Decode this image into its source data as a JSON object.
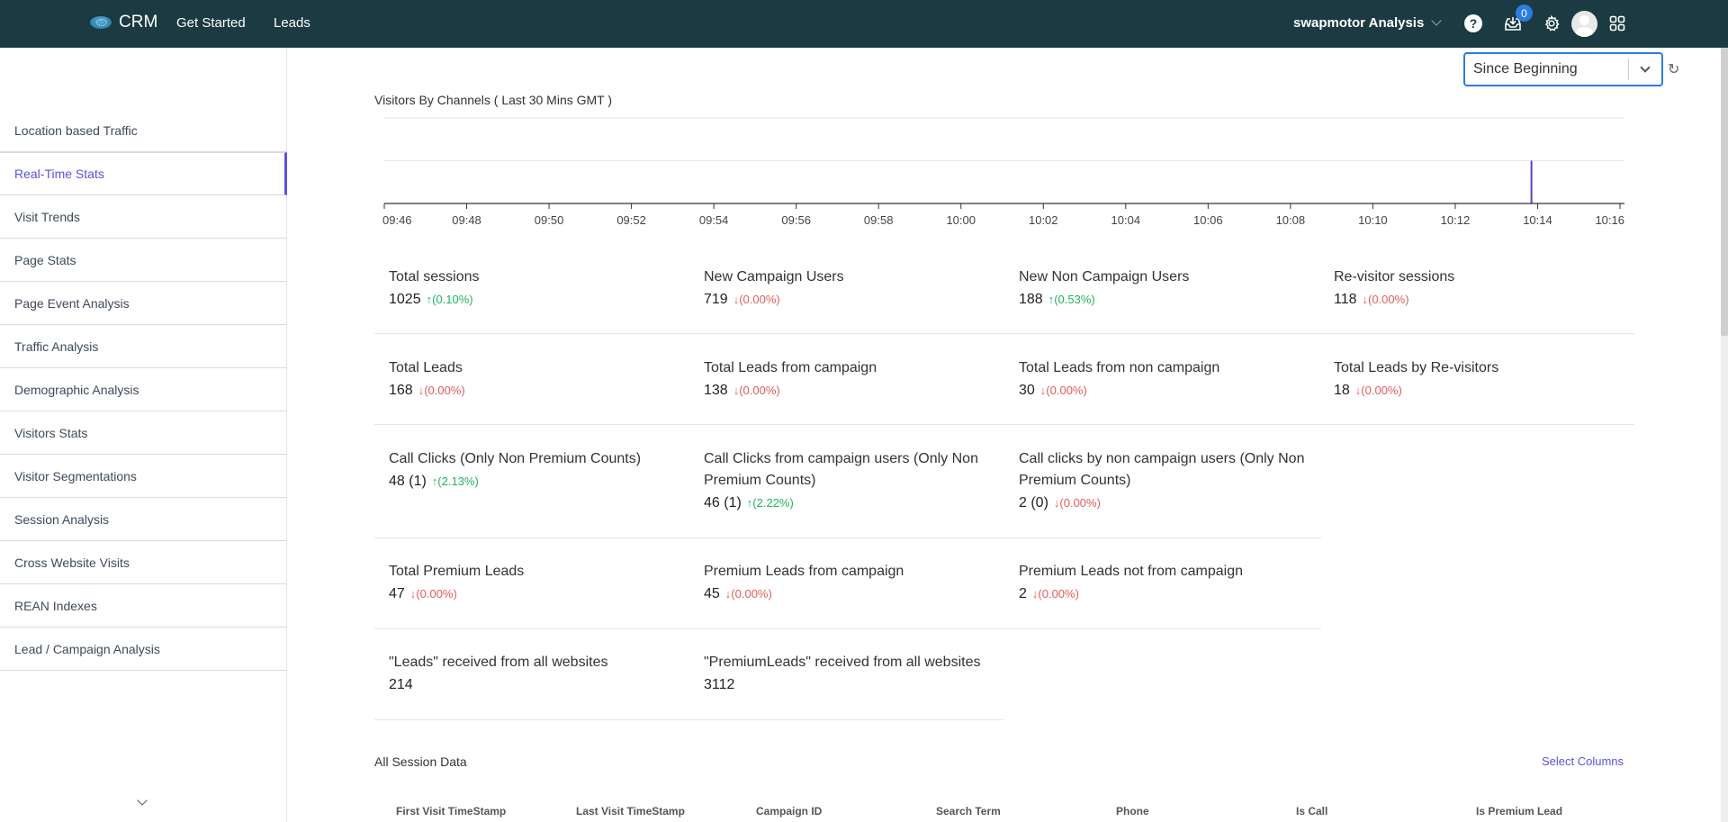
{
  "header": {
    "brand": "CRM",
    "nav": [
      "Get Started",
      "Leads"
    ],
    "account": "swapmotor Analysis",
    "notification_count": "0",
    "icons": [
      "help-icon",
      "inbox-download-icon",
      "gear-icon",
      "avatar",
      "apps-grid-icon"
    ]
  },
  "sidebar": {
    "items": [
      {
        "label": "Location based Traffic",
        "active": false
      },
      {
        "label": "Real-Time Stats",
        "active": true
      },
      {
        "label": "Visit Trends",
        "active": false
      },
      {
        "label": "Page Stats",
        "active": false
      },
      {
        "label": "Page Event Analysis",
        "active": false
      },
      {
        "label": "Traffic Analysis",
        "active": false
      },
      {
        "label": "Demographic Analysis",
        "active": false
      },
      {
        "label": "Visitors Stats",
        "active": false
      },
      {
        "label": "Visitor Segmentations",
        "active": false
      },
      {
        "label": "Session Analysis",
        "active": false
      },
      {
        "label": "Cross Website Visits",
        "active": false
      },
      {
        "label": "REAN Indexes",
        "active": false
      },
      {
        "label": "Lead / Campaign Analysis",
        "active": false
      }
    ]
  },
  "filter": {
    "range": "Since Beginning"
  },
  "chart_data": {
    "type": "bar",
    "title": "Visitors By Channels ( Last 30 Mins GMT )",
    "x_ticks": [
      "09:46",
      "09:48",
      "09:50",
      "09:52",
      "09:54",
      "09:56",
      "09:58",
      "10:00",
      "10:02",
      "10:04",
      "10:06",
      "10:08",
      "10:10",
      "10:12",
      "10:14",
      "10:16"
    ],
    "x_range_minutes": [
      0,
      30
    ],
    "ylim": [
      0,
      2
    ],
    "grid": true,
    "series": [
      {
        "name": "Visitors",
        "color": "#5048c8",
        "points": [
          {
            "x": "10:13:50",
            "minute": 27.85,
            "y": 1
          }
        ]
      }
    ]
  },
  "stats": {
    "row1": [
      {
        "label": "Total sessions",
        "value": "1025",
        "change": "↑(0.10%)",
        "dir": "up"
      },
      {
        "label": "New Campaign Users",
        "value": "719",
        "change": "↓(0.00%)",
        "dir": "down"
      },
      {
        "label": "New Non Campaign Users",
        "value": "188",
        "change": "↑(0.53%)",
        "dir": "up"
      },
      {
        "label": "Re-visitor sessions",
        "value": "118",
        "change": "↓(0.00%)",
        "dir": "down"
      }
    ],
    "row2": [
      {
        "label": "Total Leads",
        "value": "168",
        "change": "↓(0.00%)",
        "dir": "down"
      },
      {
        "label": "Total Leads from campaign",
        "value": "138",
        "change": "↓(0.00%)",
        "dir": "down"
      },
      {
        "label": "Total Leads from non campaign",
        "value": "30",
        "change": "↓(0.00%)",
        "dir": "down"
      },
      {
        "label": "Total Leads by Re-visitors",
        "value": "18",
        "change": "↓(0.00%)",
        "dir": "down"
      }
    ],
    "row3": [
      {
        "label": "Call Clicks (Only Non Premium Counts)",
        "value": "48 (1)",
        "change": "↑(2.13%)",
        "dir": "up"
      },
      {
        "label": "Call Clicks from campaign users (Only Non Premium Counts)",
        "value": "46 (1)",
        "change": "↑(2.22%)",
        "dir": "up"
      },
      {
        "label": "Call clicks by non campaign users (Only Non Premium Counts)",
        "value": "2 (0)",
        "change": "↓(0.00%)",
        "dir": "down"
      }
    ],
    "row4": [
      {
        "label": "Total Premium Leads",
        "value": "47",
        "change": "↓(0.00%)",
        "dir": "down"
      },
      {
        "label": "Premium Leads from campaign",
        "value": "45",
        "change": "↓(0.00%)",
        "dir": "down"
      },
      {
        "label": "Premium Leads not from campaign",
        "value": "2",
        "change": "↓(0.00%)",
        "dir": "down"
      }
    ],
    "row5": [
      {
        "label": "\"Leads\" received from all websites",
        "value": "214"
      },
      {
        "label": "\"PremiumLeads\" received from all websites",
        "value": "3112"
      }
    ]
  },
  "session_table": {
    "title": "All Session Data",
    "select_columns": "Select Columns",
    "columns": [
      "First Visit TimeStamp",
      "Last Visit TimeStamp",
      "Campaign ID",
      "Search Term",
      "Phone",
      "Is Call",
      "Is Premium Lead"
    ]
  }
}
